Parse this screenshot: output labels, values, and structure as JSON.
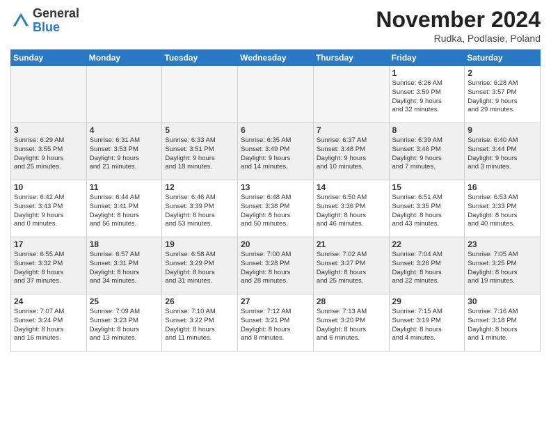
{
  "logo": {
    "general": "General",
    "blue": "Blue"
  },
  "title": "November 2024",
  "subtitle": "Rudka, Podlasie, Poland",
  "headers": [
    "Sunday",
    "Monday",
    "Tuesday",
    "Wednesday",
    "Thursday",
    "Friday",
    "Saturday"
  ],
  "weeks": [
    [
      {
        "day": "",
        "info": "",
        "empty": true
      },
      {
        "day": "",
        "info": "",
        "empty": true
      },
      {
        "day": "",
        "info": "",
        "empty": true
      },
      {
        "day": "",
        "info": "",
        "empty": true
      },
      {
        "day": "",
        "info": "",
        "empty": true
      },
      {
        "day": "1",
        "info": "Sunrise: 6:26 AM\nSunset: 3:59 PM\nDaylight: 9 hours\nand 32 minutes."
      },
      {
        "day": "2",
        "info": "Sunrise: 6:28 AM\nSunset: 3:57 PM\nDaylight: 9 hours\nand 29 minutes."
      }
    ],
    [
      {
        "day": "3",
        "info": "Sunrise: 6:29 AM\nSunset: 3:55 PM\nDaylight: 9 hours\nand 25 minutes."
      },
      {
        "day": "4",
        "info": "Sunrise: 6:31 AM\nSunset: 3:53 PM\nDaylight: 9 hours\nand 21 minutes."
      },
      {
        "day": "5",
        "info": "Sunrise: 6:33 AM\nSunset: 3:51 PM\nDaylight: 9 hours\nand 18 minutes."
      },
      {
        "day": "6",
        "info": "Sunrise: 6:35 AM\nSunset: 3:49 PM\nDaylight: 9 hours\nand 14 minutes."
      },
      {
        "day": "7",
        "info": "Sunrise: 6:37 AM\nSunset: 3:48 PM\nDaylight: 9 hours\nand 10 minutes."
      },
      {
        "day": "8",
        "info": "Sunrise: 6:39 AM\nSunset: 3:46 PM\nDaylight: 9 hours\nand 7 minutes."
      },
      {
        "day": "9",
        "info": "Sunrise: 6:40 AM\nSunset: 3:44 PM\nDaylight: 9 hours\nand 3 minutes."
      }
    ],
    [
      {
        "day": "10",
        "info": "Sunrise: 6:42 AM\nSunset: 3:43 PM\nDaylight: 9 hours\nand 0 minutes."
      },
      {
        "day": "11",
        "info": "Sunrise: 6:44 AM\nSunset: 3:41 PM\nDaylight: 8 hours\nand 56 minutes."
      },
      {
        "day": "12",
        "info": "Sunrise: 6:46 AM\nSunset: 3:39 PM\nDaylight: 8 hours\nand 53 minutes."
      },
      {
        "day": "13",
        "info": "Sunrise: 6:48 AM\nSunset: 3:38 PM\nDaylight: 8 hours\nand 50 minutes."
      },
      {
        "day": "14",
        "info": "Sunrise: 6:50 AM\nSunset: 3:36 PM\nDaylight: 8 hours\nand 46 minutes."
      },
      {
        "day": "15",
        "info": "Sunrise: 6:51 AM\nSunset: 3:35 PM\nDaylight: 8 hours\nand 43 minutes."
      },
      {
        "day": "16",
        "info": "Sunrise: 6:53 AM\nSunset: 3:33 PM\nDaylight: 8 hours\nand 40 minutes."
      }
    ],
    [
      {
        "day": "17",
        "info": "Sunrise: 6:55 AM\nSunset: 3:32 PM\nDaylight: 8 hours\nand 37 minutes."
      },
      {
        "day": "18",
        "info": "Sunrise: 6:57 AM\nSunset: 3:31 PM\nDaylight: 8 hours\nand 34 minutes."
      },
      {
        "day": "19",
        "info": "Sunrise: 6:58 AM\nSunset: 3:29 PM\nDaylight: 8 hours\nand 31 minutes."
      },
      {
        "day": "20",
        "info": "Sunrise: 7:00 AM\nSunset: 3:28 PM\nDaylight: 8 hours\nand 28 minutes."
      },
      {
        "day": "21",
        "info": "Sunrise: 7:02 AM\nSunset: 3:27 PM\nDaylight: 8 hours\nand 25 minutes."
      },
      {
        "day": "22",
        "info": "Sunrise: 7:04 AM\nSunset: 3:26 PM\nDaylight: 8 hours\nand 22 minutes."
      },
      {
        "day": "23",
        "info": "Sunrise: 7:05 AM\nSunset: 3:25 PM\nDaylight: 8 hours\nand 19 minutes."
      }
    ],
    [
      {
        "day": "24",
        "info": "Sunrise: 7:07 AM\nSunset: 3:24 PM\nDaylight: 8 hours\nand 16 minutes."
      },
      {
        "day": "25",
        "info": "Sunrise: 7:09 AM\nSunset: 3:23 PM\nDaylight: 8 hours\nand 13 minutes."
      },
      {
        "day": "26",
        "info": "Sunrise: 7:10 AM\nSunset: 3:22 PM\nDaylight: 8 hours\nand 11 minutes."
      },
      {
        "day": "27",
        "info": "Sunrise: 7:12 AM\nSunset: 3:21 PM\nDaylight: 8 hours\nand 8 minutes."
      },
      {
        "day": "28",
        "info": "Sunrise: 7:13 AM\nSunset: 3:20 PM\nDaylight: 8 hours\nand 6 minutes."
      },
      {
        "day": "29",
        "info": "Sunrise: 7:15 AM\nSunset: 3:19 PM\nDaylight: 8 hours\nand 4 minutes."
      },
      {
        "day": "30",
        "info": "Sunrise: 7:16 AM\nSunset: 3:18 PM\nDaylight: 8 hours\nand 1 minute."
      }
    ]
  ]
}
